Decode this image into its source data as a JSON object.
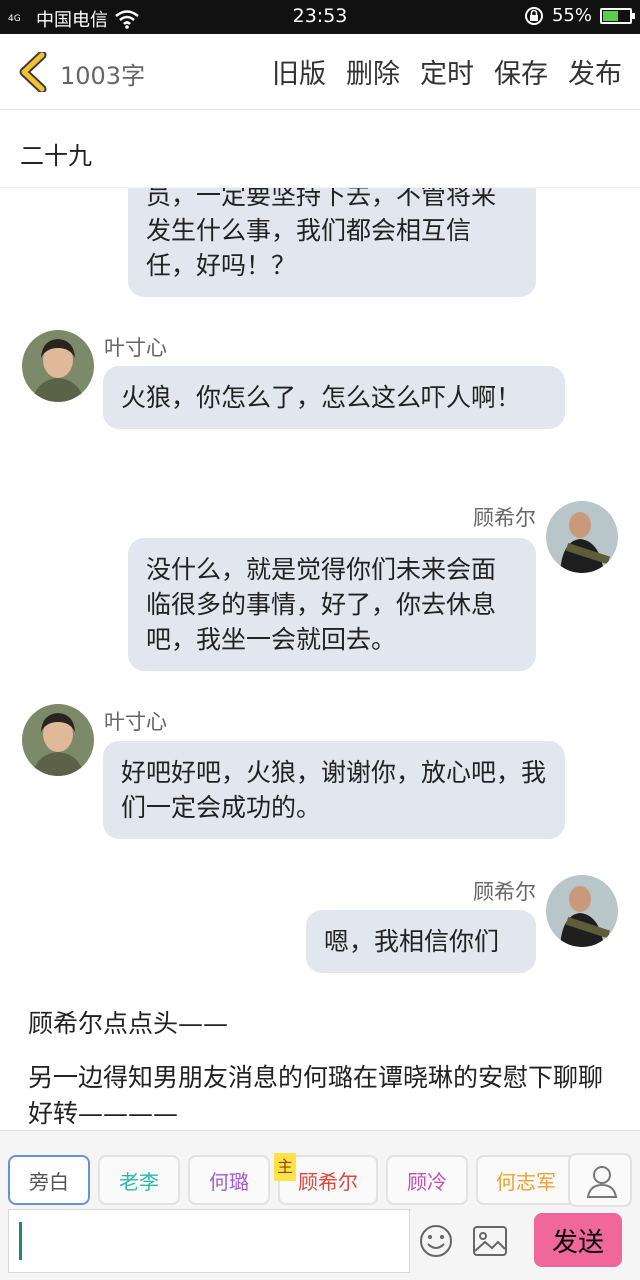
{
  "status_bar": {
    "network": "4G",
    "carrier": "中国电信",
    "time": "23:53",
    "battery_text": "55%",
    "battery_level": 0.55
  },
  "header": {
    "word_count": "1003字",
    "actions": [
      "旧版",
      "删除",
      "定时",
      "保存",
      "发布"
    ]
  },
  "chapter_title": "二十九",
  "messages": [
    {
      "speaker": "",
      "side": "right",
      "text": "员，一定要坚持下去，不管将来发生什么事，我们都会相互信任，好吗！？"
    },
    {
      "speaker": "叶寸心",
      "side": "left",
      "text": "火狼，你怎么了，怎么这么吓人啊！"
    },
    {
      "speaker": "顾希尔",
      "side": "right",
      "text": "没什么，就是觉得你们未来会面临很多的事情，好了，你去休息吧，我坐一会就回去。"
    },
    {
      "speaker": "叶寸心",
      "side": "left",
      "text": "好吧好吧，火狼，谢谢你，放心吧，我们一定会成功的。"
    },
    {
      "speaker": "顾希尔",
      "side": "right",
      "text": "嗯，我相信你们"
    }
  ],
  "narration": [
    "顾希尔点点头——",
    "另一边得知男朋友消息的何璐在谭晓琳的安慰下聊聊好转————"
  ],
  "roles": [
    {
      "label": "旁白",
      "color": "#555555"
    },
    {
      "label": "老李",
      "color": "#2bb8a8"
    },
    {
      "label": "何璐",
      "color": "#a35bd6"
    },
    {
      "label": "顾希尔",
      "color": "#e0473e"
    },
    {
      "label": "顾冷",
      "color": "#c84fb0"
    },
    {
      "label": "何志军",
      "color": "#f0a030"
    }
  ],
  "host_badge": "主",
  "input": {
    "value": ""
  },
  "send_label": "发送",
  "colors": {
    "accent": "#f0679a",
    "bubble": "#e2e7ef",
    "back_icon": "#f2c230"
  }
}
